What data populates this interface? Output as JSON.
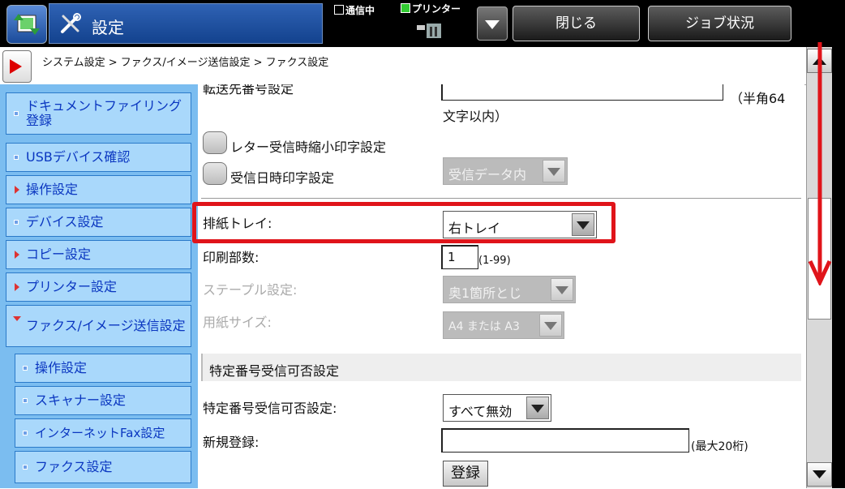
{
  "header": {
    "title": "設定",
    "status_comm": "通信中",
    "status_printer": "プリンター",
    "close_label": "閉じる",
    "job_label": "ジョブ状況"
  },
  "breadcrumb": "システム設定 > ファクス/イメージ送信設定 > ファクス設定",
  "sidebar": {
    "items": [
      {
        "label": "ドキュメントファイリング登録",
        "marker": "square"
      },
      {
        "label": "USBデバイス確認",
        "marker": "square"
      },
      {
        "label": "操作設定",
        "marker": "triangle"
      },
      {
        "label": "デバイス設定",
        "marker": "square"
      },
      {
        "label": "コピー設定",
        "marker": "triangle"
      },
      {
        "label": "プリンター設定",
        "marker": "triangle"
      },
      {
        "label": "ファクス/イメージ送信設定",
        "marker": "triangle-open"
      },
      {
        "label": "操作設定",
        "marker": "square"
      },
      {
        "label": "スキャナー設定",
        "marker": "square"
      },
      {
        "label": "インターネットFax設定",
        "marker": "square"
      },
      {
        "label": "ファクス設定",
        "marker": "square"
      }
    ]
  },
  "form": {
    "forward_label": "転送先番号設定",
    "forward_hint_1": "（半角64",
    "forward_hint_2": "文字以内）",
    "reduced_print_label": "レター受信時縮小印字設定",
    "receive_date_label": "受信日時印字設定",
    "receive_date_select": "受信データ内",
    "output_tray_label": "排紙トレイ:",
    "output_tray_value": "右トレイ",
    "copies_label": "印刷部数:",
    "copies_value": "1",
    "copies_range": "(1-99)",
    "staple_label": "ステープル設定:",
    "staple_value": "奥1箇所とじ",
    "paper_label": "用紙サイズ:",
    "paper_value": "A4 または A3",
    "section_title": "特定番号受信可否設定",
    "specific_label": "特定番号受信可否設定:",
    "specific_value": "すべて無効",
    "new_reg_label": "新規登録:",
    "new_reg_hint": "(最大20桁)",
    "register_button": "登録"
  },
  "colors": {
    "highlight": "#e0141a",
    "sidebar_bg": "#7bbdf0",
    "sidebar_item": "#a9d8fb",
    "sidebar_text": "#0a36c0"
  }
}
